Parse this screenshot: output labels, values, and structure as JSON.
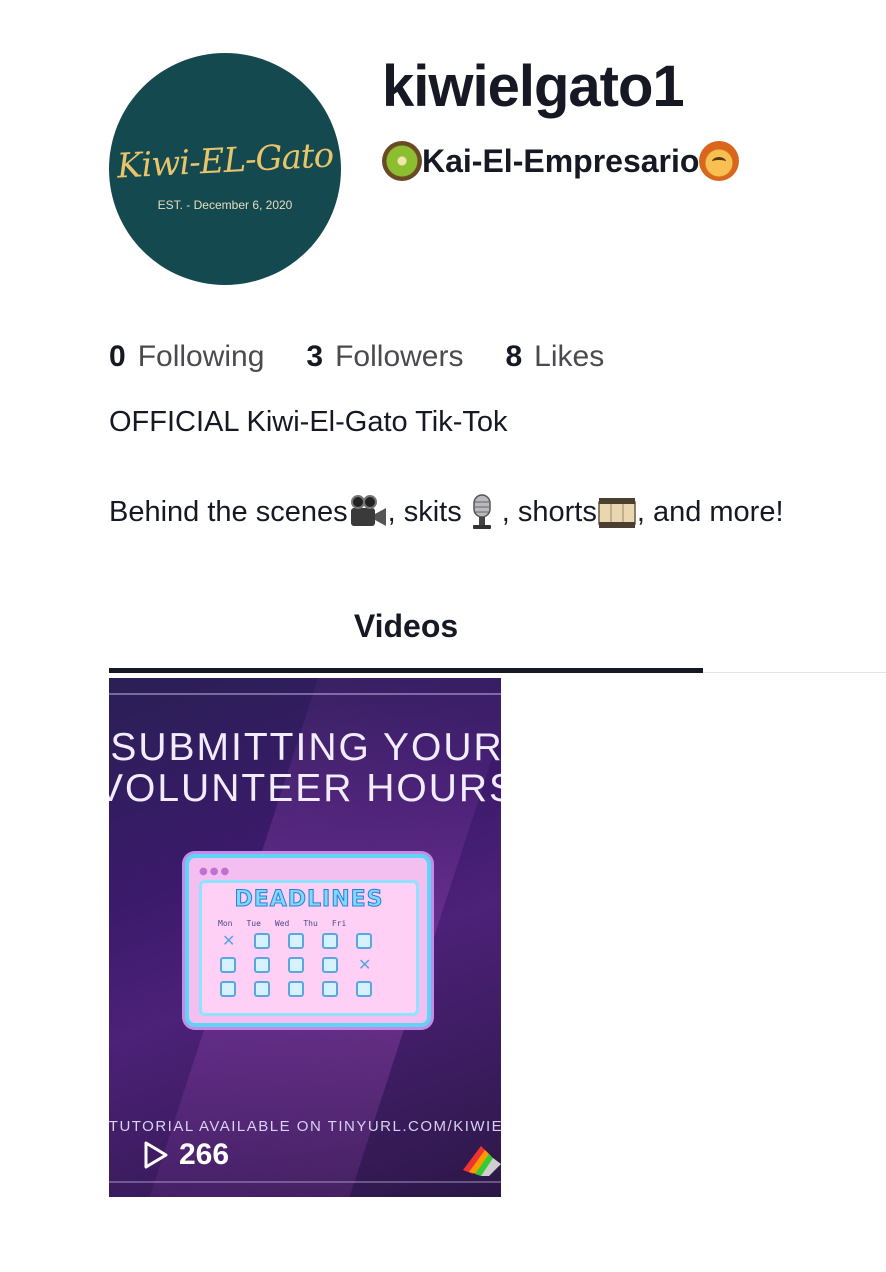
{
  "profile": {
    "avatar": {
      "brand_text": "Kiwi-EL-Gato",
      "est_text": "EST. - December 6, 2020",
      "bg_color": "#144a4f",
      "text_color": "#e9c46a"
    },
    "username": "kiwielgato1",
    "nickname": {
      "text": "Kai-El-Empresario",
      "leading_icon": "kiwi-emoji",
      "trailing_icon": "lion-emoji"
    }
  },
  "stats": [
    {
      "count": "0",
      "label": "Following"
    },
    {
      "count": "3",
      "label": "Followers"
    },
    {
      "count": "8",
      "label": "Likes"
    }
  ],
  "bio": {
    "line1": "OFFICIAL Kiwi-El-Gato Tik-Tok",
    "line2_parts": [
      "Behind the scenes",
      ", skits",
      ", shorts",
      ", and more!"
    ],
    "icons": [
      "video-camera-emoji",
      "microphone-emoji",
      "film-emoji"
    ]
  },
  "tabs": [
    {
      "label": "Videos",
      "active": true
    }
  ],
  "videos": [
    {
      "title_line1": "SUBMITTING YOUR",
      "title_line2": "VOLUNTEER HOURS",
      "calendar_heading": "DEADLINES",
      "calendar_days": [
        "Mon",
        "Tue",
        "Wed",
        "Thu",
        "Fri"
      ],
      "footer_text": "TUTORIAL AVAILABLE ON TINYURL.COM/KIWIE",
      "views": "266",
      "view_icon": "play-icon"
    }
  ]
}
